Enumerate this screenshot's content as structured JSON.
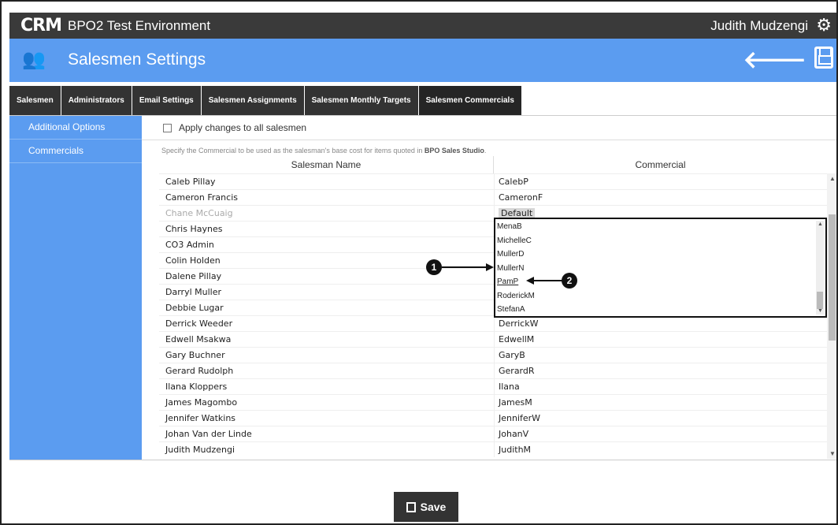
{
  "topbar": {
    "logo": "CRM",
    "app_title": "BPO2 Test Environment",
    "user": "Judith Mudzengi"
  },
  "header": {
    "title": "Salesmen Settings"
  },
  "tabs": [
    {
      "label": "Salesmen"
    },
    {
      "label": "Administrators"
    },
    {
      "label": "Email Settings"
    },
    {
      "label": "Salesmen Assignments"
    },
    {
      "label": "Salesmen Monthly Targets"
    },
    {
      "label": "Salesmen Commercials",
      "active": true
    }
  ],
  "sidebar": {
    "items": [
      {
        "label": "Additional Options"
      },
      {
        "label": "Commercials"
      }
    ]
  },
  "options": {
    "apply_all_label": "Apply changes to all salesmen",
    "apply_all_checked": false
  },
  "description": {
    "text": "Specify the Commercial to be used as the salesman's base cost for items quoted in ",
    "product": "BPO Sales Studio",
    "end": "."
  },
  "table": {
    "headers": {
      "name": "Salesman Name",
      "commercial": "Commercial"
    },
    "rows": [
      {
        "name": "Caleb Pillay",
        "commercial": "CalebP"
      },
      {
        "name": "Cameron Francis",
        "commercial": "CameronF"
      },
      {
        "name": "Chane McCuaig",
        "commercial": "Default"
      },
      {
        "name": "Chris Haynes",
        "commercial": ""
      },
      {
        "name": "CO3 Admin",
        "commercial": ""
      },
      {
        "name": "Colin Holden",
        "commercial": ""
      },
      {
        "name": "Dalene Pillay",
        "commercial": ""
      },
      {
        "name": "Darryl Muller",
        "commercial": ""
      },
      {
        "name": "Debbie Lugar",
        "commercial": ""
      },
      {
        "name": "Derrick Weeder",
        "commercial": "DerrickW"
      },
      {
        "name": "Edwell Msakwa",
        "commercial": "EdwellM"
      },
      {
        "name": "Gary Buchner",
        "commercial": "GaryB"
      },
      {
        "name": "Gerard Rudolph",
        "commercial": "GerardR"
      },
      {
        "name": "Ilana Kloppers",
        "commercial": "Ilana"
      },
      {
        "name": "James Magombo",
        "commercial": "JamesM"
      },
      {
        "name": "Jennifer Watkins",
        "commercial": "JenniferW"
      },
      {
        "name": "Johan Van der Linde",
        "commercial": "JohanV"
      },
      {
        "name": "Judith Mudzengi",
        "commercial": "JudithM"
      }
    ]
  },
  "dropdown": {
    "options": [
      "MenaB",
      "MichelleC",
      "MullerD",
      "MullerN",
      "PamP",
      "RoderickM",
      "StefanA"
    ],
    "highlighted": "PamP"
  },
  "callouts": {
    "one": "1",
    "two": "2"
  },
  "save_button": {
    "label": "Save"
  }
}
